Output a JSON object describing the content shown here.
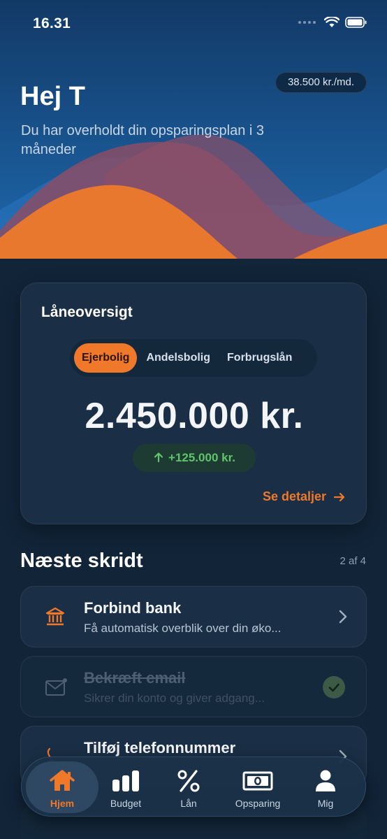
{
  "status_bar": {
    "time": "16.31"
  },
  "header": {
    "budget": "38.500 kr./md.",
    "greeting": "Hej T",
    "subtitle": "Du har overholdt din opsparingsplan i 3 måneder"
  },
  "loan_overview": {
    "title": "Låneoversigt",
    "tabs": [
      {
        "label": "Ejerbolig",
        "active": true
      },
      {
        "label": "Andelsbolig",
        "active": false
      },
      {
        "label": "Forbrugslån",
        "active": false
      }
    ],
    "amount": "2.450.000 kr.",
    "change": "+125.000 kr.",
    "details_link": "Se detaljer"
  },
  "next_steps": {
    "title": "Næste skridt",
    "count": "2 af 4",
    "items": [
      {
        "title": "Forbind bank",
        "description": "Få automatisk overblik over din øko...",
        "icon": "bank-icon",
        "done": false
      },
      {
        "title": "Bekræft email",
        "description": "Sikrer din konto og giver adgang...",
        "icon": "mail-icon",
        "done": true
      },
      {
        "title": "Tilføj telefonnummer",
        "description": "",
        "icon": "phone-icon",
        "done": false
      }
    ]
  },
  "tabbar": {
    "items": [
      {
        "label": "Hjem",
        "icon": "home-icon",
        "active": true
      },
      {
        "label": "Budget",
        "icon": "bar-chart-icon",
        "active": false
      },
      {
        "label": "Lån",
        "icon": "percent-icon",
        "active": false
      },
      {
        "label": "Opsparing",
        "icon": "banknote-icon",
        "active": false
      },
      {
        "label": "Mig",
        "icon": "person-icon",
        "active": false
      }
    ]
  },
  "colors": {
    "accent": "#f0782a",
    "positive": "#5fc46a",
    "background": "#112438",
    "card": "#1a2f45",
    "hero_blue": "#1a5a98"
  }
}
